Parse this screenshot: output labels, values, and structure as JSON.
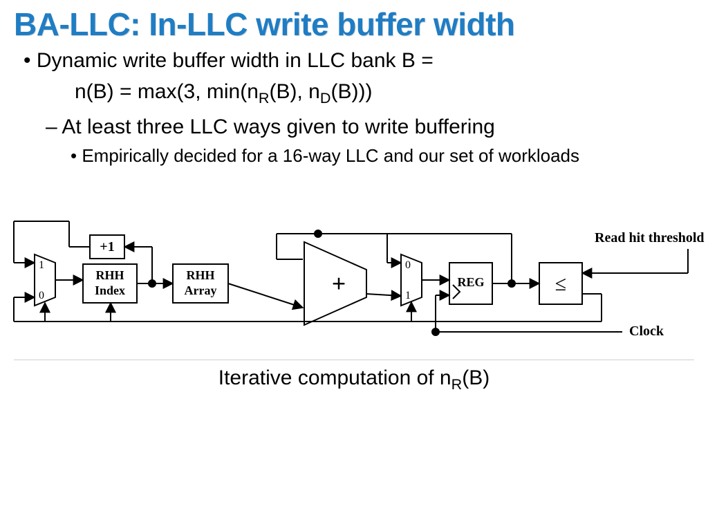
{
  "title": "BA-LLC: In-LLC write buffer width",
  "b1": "Dynamic write buffer width in LLC bank B =",
  "b1cont_prefix": "n(B) = max(3, min(n",
  "b1cont_sub1": "R",
  "b1cont_mid": "(B), n",
  "b1cont_sub2": "D",
  "b1cont_suffix": "(B)))",
  "b2": "At least three LLC ways given to write buffering",
  "b3": "Empirically decided for a 16-way LLC and our set of workloads",
  "caption_prefix": "Iterative computation of n",
  "caption_sub": "R",
  "caption_suffix": "(B)",
  "diagram": {
    "mux1": {
      "top": "1",
      "bot": "0"
    },
    "plus1_box": "+1",
    "rhh_index_l1": "RHH",
    "rhh_index_l2": "Index",
    "rhh_array_l1": "RHH",
    "rhh_array_l2": "Array",
    "adder": "+",
    "mux2": {
      "top": "0",
      "bot": "1"
    },
    "reg": "REG",
    "cmp": "≤",
    "label_rht": "Read hit threshold",
    "label_clk": "Clock"
  }
}
